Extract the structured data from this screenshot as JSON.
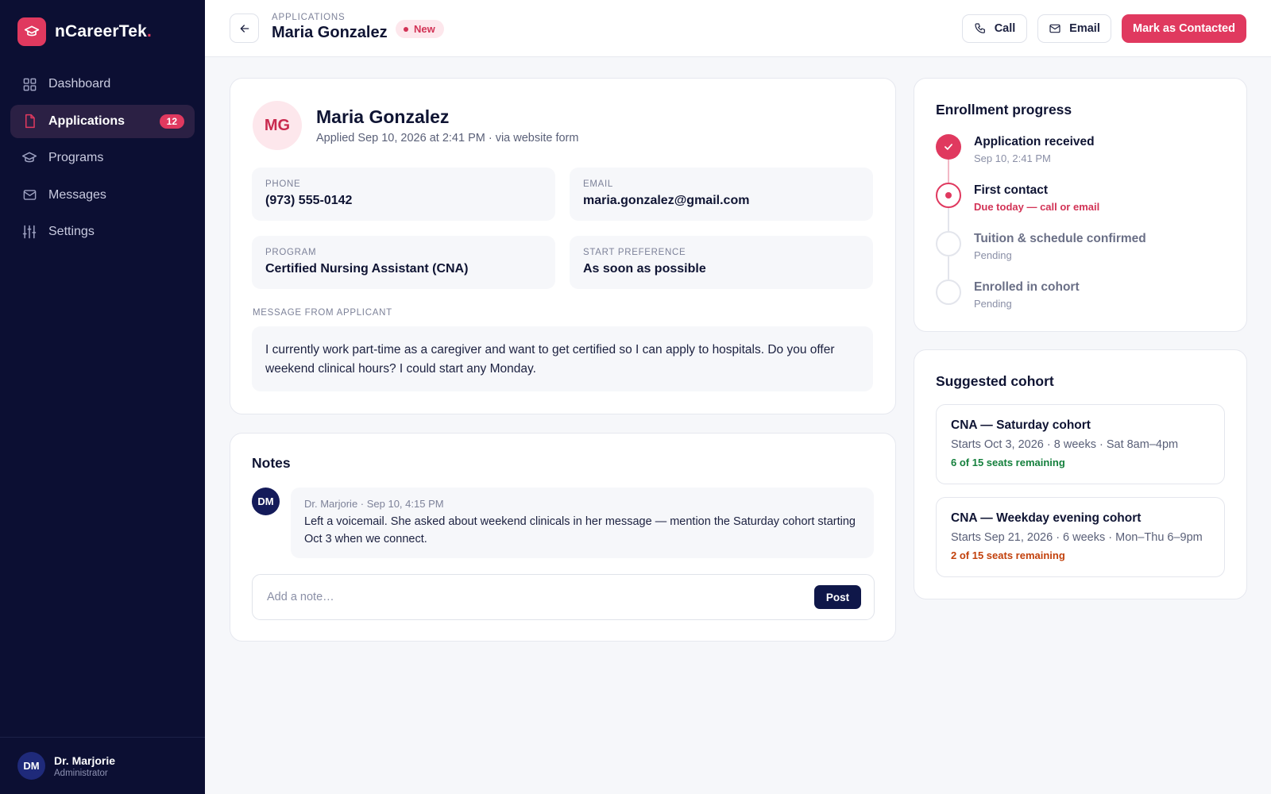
{
  "app": {
    "name": "nCareerTek",
    "dot": "."
  },
  "sidebar": {
    "items": [
      {
        "label": "Dashboard",
        "icon": "grid-icon"
      },
      {
        "label": "Applications",
        "icon": "file-icon",
        "badge": "12",
        "active": true
      },
      {
        "label": "Programs",
        "icon": "graduation-cap-icon"
      },
      {
        "label": "Messages",
        "icon": "mail-icon"
      },
      {
        "label": "Settings",
        "icon": "sliders-icon"
      }
    ],
    "user": {
      "initials": "DM",
      "name": "Dr. Marjorie",
      "role": "Administrator"
    }
  },
  "header": {
    "breadcrumb": "APPLICATIONS",
    "title": "Maria Gonzalez",
    "status": "New",
    "call_label": "Call",
    "email_label": "Email",
    "contacted_label": "Mark as Contacted"
  },
  "applicant": {
    "initials": "MG",
    "name": "Maria Gonzalez",
    "applied": "Applied Sep 10, 2026 at 2:41 PM · via website form",
    "phone_label": "PHONE",
    "phone": "(973) 555-0142",
    "email_label": "EMAIL",
    "email": "maria.gonzalez@gmail.com",
    "program_label": "PROGRAM",
    "program": "Certified Nursing Assistant (CNA)",
    "start_label": "START PREFERENCE",
    "start": "As soon as possible",
    "message_label": "MESSAGE FROM APPLICANT",
    "message": "I currently work part-time as a caregiver and want to get certified so I can apply to hospitals. Do you offer weekend clinical hours? I could start any Monday."
  },
  "notes": {
    "title": "Notes",
    "items": [
      {
        "initials": "DM",
        "meta": "Dr. Marjorie · Sep 10, 4:15 PM",
        "text": "Left a voicemail. She asked about weekend clinicals in her message — mention the Saturday cohort starting Oct 3 when we connect."
      }
    ],
    "placeholder": "Add a note…",
    "post_label": "Post"
  },
  "progress": {
    "title": "Enrollment progress",
    "steps": [
      {
        "title": "Application received",
        "sub": "Sep 10, 2:41 PM",
        "state": "done"
      },
      {
        "title": "First contact",
        "sub": "Due today — call or email",
        "state": "current"
      },
      {
        "title": "Tuition & schedule confirmed",
        "sub": "Pending",
        "state": "pending"
      },
      {
        "title": "Enrolled in cohort",
        "sub": "Pending",
        "state": "pending"
      }
    ]
  },
  "cohorts": {
    "title": "Suggested cohort",
    "items": [
      {
        "title": "CNA — Saturday cohort",
        "meta": "Starts Oct 3, 2026 · 8 weeks · Sat 8am–4pm",
        "seats": "6 of 15 seats remaining",
        "seats_color": "#15803d"
      },
      {
        "title": "CNA — Weekday evening cohort",
        "meta": "Starts Sep 21, 2026 · 6 weeks · Mon–Thu 6–9pm",
        "seats": "2 of 15 seats remaining",
        "seats_color": "#c2410c"
      }
    ]
  },
  "colors": {
    "accent": "#e0395f",
    "sidebar": "#0c0f33",
    "navy": "#0f1749"
  }
}
